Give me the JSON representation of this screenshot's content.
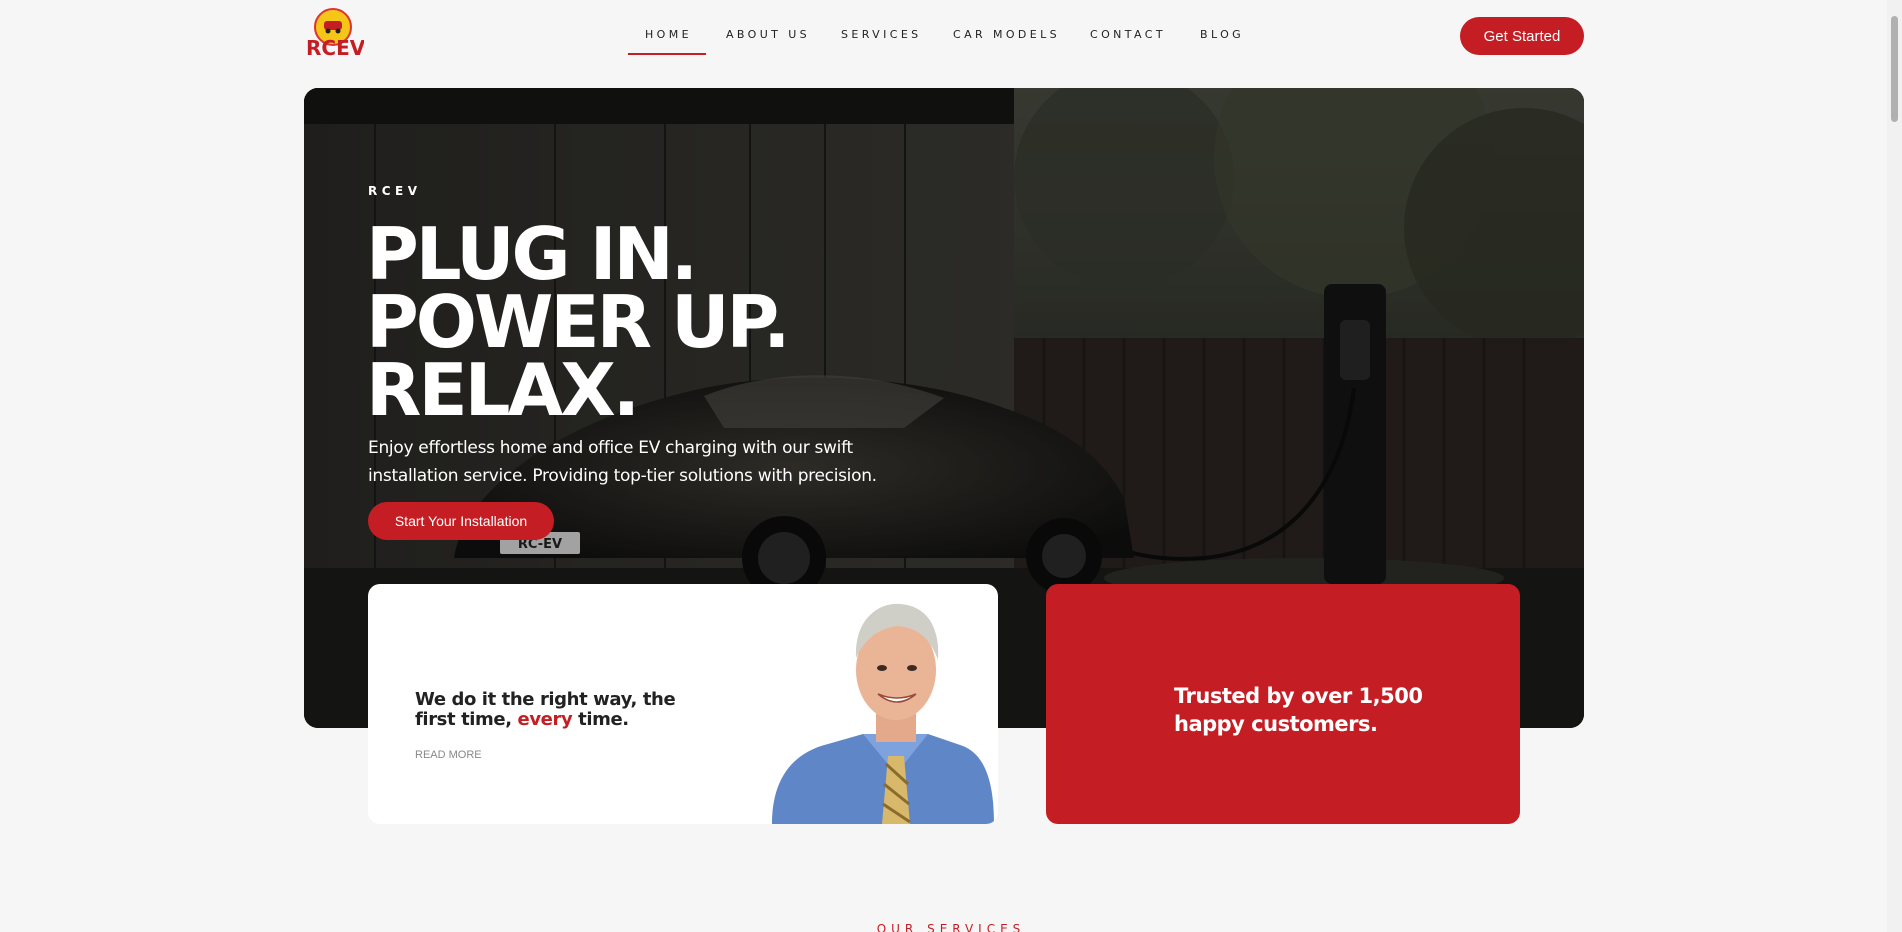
{
  "header": {
    "logo_text": "RCEV",
    "nav": [
      {
        "label": "HOME",
        "active": true
      },
      {
        "label": "ABOUT US",
        "active": false
      },
      {
        "label": "SERVICES",
        "active": false
      },
      {
        "label": "CAR MODELS",
        "active": false
      },
      {
        "label": "CONTACT",
        "active": false
      },
      {
        "label": "BLOG",
        "active": false
      }
    ],
    "cta_label": "Get Started"
  },
  "hero": {
    "eyebrow": "RCEV",
    "headline": [
      "PLUG IN.",
      "POWER UP.",
      "RELAX."
    ],
    "subtext": "Enjoy effortless home and office EV charging with our swift installation service. Providing top-tier solutions with precision.",
    "cta_label": "Start Your Installation",
    "plate_text": "RC-EV"
  },
  "card_white": {
    "title_before": "We do it the right way, the first time, ",
    "title_accent": "every",
    "title_after": " time.",
    "link_label": "READ MORE"
  },
  "card_red": {
    "text": "Trusted by over 1,500 happy customers."
  },
  "services": {
    "eyebrow": "OUR SERVICES"
  },
  "colors": {
    "accent": "#c41e24",
    "page_bg": "#f6f6f6"
  }
}
